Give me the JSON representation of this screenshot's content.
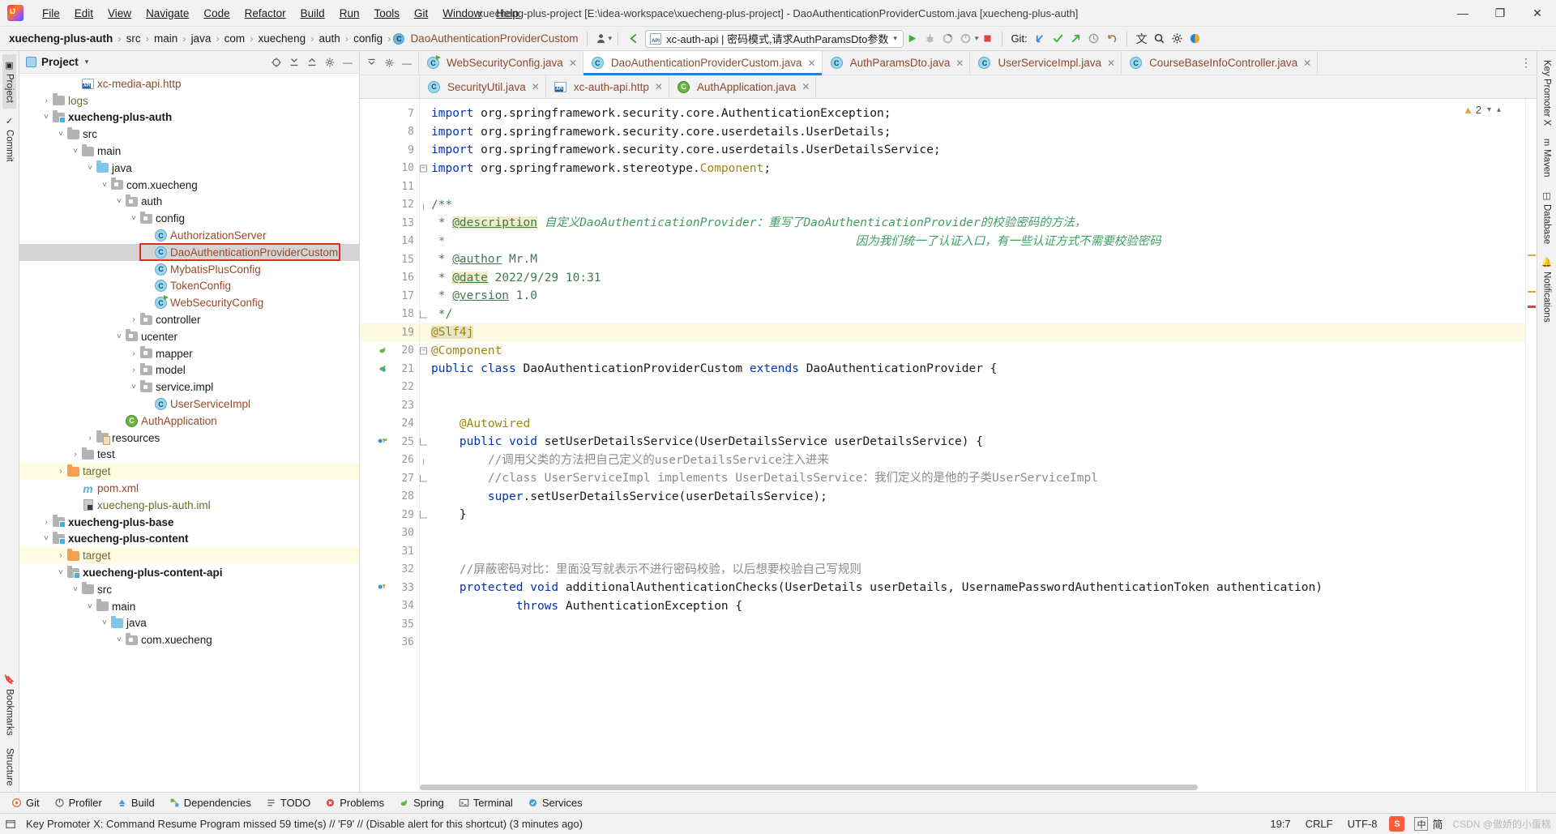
{
  "window": {
    "title": "xuecheng-plus-project [E:\\idea-workspace\\xuecheng-plus-project] - DaoAuthenticationProviderCustom.java [xuecheng-plus-auth]",
    "minimize": "—",
    "maximize": "❐",
    "close": "✕"
  },
  "menu": [
    {
      "label": "File"
    },
    {
      "label": "Edit"
    },
    {
      "label": "View"
    },
    {
      "label": "Navigate"
    },
    {
      "label": "Code"
    },
    {
      "label": "Refactor"
    },
    {
      "label": "Build"
    },
    {
      "label": "Run"
    },
    {
      "label": "Tools"
    },
    {
      "label": "Git"
    },
    {
      "label": "Window"
    },
    {
      "label": "Help"
    }
  ],
  "navbar": {
    "crumbs": [
      {
        "label": "xuecheng-plus-auth",
        "style": "bold"
      },
      {
        "label": "src",
        "style": "normal"
      },
      {
        "label": "main",
        "style": "normal"
      },
      {
        "label": "java",
        "style": "normal"
      },
      {
        "label": "com",
        "style": "normal"
      },
      {
        "label": "xuecheng",
        "style": "normal"
      },
      {
        "label": "auth",
        "style": "normal"
      },
      {
        "label": "config",
        "style": "normal"
      },
      {
        "label": "DaoAuthenticationProviderCustom",
        "style": "class"
      }
    ],
    "separator": "›",
    "run_config": "xc-auth-api | 密码模式,请求AuthParamsDto参数",
    "run_config_caret": "▾",
    "api_badge": "API",
    "git_label": "Git:"
  },
  "left_strip": [
    {
      "label": "Project",
      "icon": "project-icon",
      "active": true
    },
    {
      "label": "Commit",
      "icon": "commit-icon",
      "active": false
    },
    {
      "label": "Bookmarks",
      "icon": "bookmarks-icon",
      "active": false
    },
    {
      "label": "Structure",
      "icon": "structure-icon",
      "active": false
    }
  ],
  "right_strip": [
    {
      "label": "Key Promoter X",
      "icon": "key-icon"
    },
    {
      "label": "Maven",
      "icon": "maven-icon"
    },
    {
      "label": "Database",
      "icon": "database-icon"
    },
    {
      "label": "Notifications",
      "icon": "bell-icon"
    }
  ],
  "project_panel": {
    "title": "Project",
    "caret": "▾",
    "tree": [
      {
        "depth": 4,
        "arrow": "",
        "icon": "http-file",
        "label": "xc-media-api.http",
        "style": "file"
      },
      {
        "depth": 2,
        "arrow": "›",
        "icon": "folder-gray",
        "label": "logs",
        "style": "olive"
      },
      {
        "depth": 2,
        "arrow": "˅",
        "icon": "folder-module",
        "label": "xuecheng-plus-auth",
        "style": "bold"
      },
      {
        "depth": 3,
        "arrow": "˅",
        "icon": "folder-gray",
        "label": "src",
        "style": "normal"
      },
      {
        "depth": 4,
        "arrow": "˅",
        "icon": "folder-gray",
        "label": "main",
        "style": "normal"
      },
      {
        "depth": 5,
        "arrow": "˅",
        "icon": "folder-blue",
        "label": "java",
        "style": "normal"
      },
      {
        "depth": 6,
        "arrow": "˅",
        "icon": "folder-pkg",
        "label": "com.xuecheng",
        "style": "normal"
      },
      {
        "depth": 7,
        "arrow": "˅",
        "icon": "folder-pkg",
        "label": "auth",
        "style": "normal"
      },
      {
        "depth": 8,
        "arrow": "˅",
        "icon": "folder-pkg",
        "label": "config",
        "style": "normal"
      },
      {
        "depth": 9,
        "arrow": "",
        "icon": "class",
        "label": "AuthorizationServer",
        "style": "class"
      },
      {
        "depth": 9,
        "arrow": "",
        "icon": "class",
        "label": "DaoAuthenticationProviderCustom",
        "style": "class",
        "selected": true,
        "highlighted": true
      },
      {
        "depth": 9,
        "arrow": "",
        "icon": "class",
        "label": "MybatisPlusConfig",
        "style": "class"
      },
      {
        "depth": 9,
        "arrow": "",
        "icon": "class",
        "label": "TokenConfig",
        "style": "class"
      },
      {
        "depth": 9,
        "arrow": "",
        "icon": "class-run",
        "label": "WebSecurityConfig",
        "style": "class"
      },
      {
        "depth": 8,
        "arrow": "›",
        "icon": "folder-pkg",
        "label": "controller",
        "style": "normal"
      },
      {
        "depth": 7,
        "arrow": "˅",
        "icon": "folder-pkg",
        "label": "ucenter",
        "style": "normal"
      },
      {
        "depth": 8,
        "arrow": "›",
        "icon": "folder-pkg",
        "label": "mapper",
        "style": "normal"
      },
      {
        "depth": 8,
        "arrow": "›",
        "icon": "folder-pkg",
        "label": "model",
        "style": "normal"
      },
      {
        "depth": 8,
        "arrow": "˅",
        "icon": "folder-pkg",
        "label": "service.impl",
        "style": "normal"
      },
      {
        "depth": 9,
        "arrow": "",
        "icon": "class",
        "label": "UserServiceImpl",
        "style": "class"
      },
      {
        "depth": 7,
        "arrow": "",
        "icon": "spring-class",
        "label": "AuthApplication",
        "style": "class"
      },
      {
        "depth": 5,
        "arrow": "›",
        "icon": "folder-res",
        "label": "resources",
        "style": "normal"
      },
      {
        "depth": 4,
        "arrow": "›",
        "icon": "folder-gray",
        "label": "test",
        "style": "normal"
      },
      {
        "depth": 3,
        "arrow": "›",
        "icon": "folder-orange",
        "label": "target",
        "style": "olive",
        "row_highlight": true
      },
      {
        "depth": 4,
        "arrow": "",
        "icon": "maven",
        "label": "pom.xml",
        "style": "file"
      },
      {
        "depth": 4,
        "arrow": "",
        "icon": "iml",
        "label": "xuecheng-plus-auth.iml",
        "style": "olive"
      },
      {
        "depth": 2,
        "arrow": "›",
        "icon": "folder-module",
        "label": "xuecheng-plus-base",
        "style": "bold"
      },
      {
        "depth": 2,
        "arrow": "˅",
        "icon": "folder-module",
        "label": "xuecheng-plus-content",
        "style": "bold"
      },
      {
        "depth": 3,
        "arrow": "›",
        "icon": "folder-orange",
        "label": "target",
        "style": "olive",
        "row_highlight": true
      },
      {
        "depth": 3,
        "arrow": "˅",
        "icon": "folder-module",
        "label": "xuecheng-plus-content-api",
        "style": "bold"
      },
      {
        "depth": 4,
        "arrow": "˅",
        "icon": "folder-gray",
        "label": "src",
        "style": "normal"
      },
      {
        "depth": 5,
        "arrow": "˅",
        "icon": "folder-gray",
        "label": "main",
        "style": "normal"
      },
      {
        "depth": 6,
        "arrow": "˅",
        "icon": "folder-blue",
        "label": "java",
        "style": "normal"
      },
      {
        "depth": 7,
        "arrow": "˅",
        "icon": "folder-pkg",
        "label": "com.xuecheng",
        "style": "normal"
      }
    ]
  },
  "editor_tabs_row1": [
    {
      "label": "WebSecurityConfig.java",
      "icon": "class-run",
      "active": false
    },
    {
      "label": "DaoAuthenticationProviderCustom.java",
      "icon": "class",
      "active": true
    },
    {
      "label": "AuthParamsDto.java",
      "icon": "class",
      "active": false
    },
    {
      "label": "UserServiceImpl.java",
      "icon": "class",
      "active": false
    },
    {
      "label": "CourseBaseInfoController.java",
      "icon": "class",
      "active": false
    }
  ],
  "editor_tabs_row2": [
    {
      "label": "SecurityUtil.java",
      "icon": "class",
      "active": false
    },
    {
      "label": "xc-auth-api.http",
      "icon": "http-file",
      "active": false
    },
    {
      "label": "AuthApplication.java",
      "icon": "spring-class",
      "active": false
    }
  ],
  "editor": {
    "warning_count": "2",
    "warning_icon": "warning-triangle-icon",
    "first_line": 7,
    "current_line": 19,
    "lines": [
      {
        "n": 7,
        "tokens": [
          {
            "t": "import ",
            "c": "kw"
          },
          {
            "t": "org.springframework.security.core.AuthenticationException;",
            "c": "plain"
          }
        ]
      },
      {
        "n": 8,
        "tokens": [
          {
            "t": "import ",
            "c": "kw"
          },
          {
            "t": "org.springframework.security.core.userdetails.UserDetails;",
            "c": "plain"
          }
        ]
      },
      {
        "n": 9,
        "tokens": [
          {
            "t": "import ",
            "c": "kw"
          },
          {
            "t": "org.springframework.security.core.userdetails.UserDetailsService;",
            "c": "plain"
          }
        ]
      },
      {
        "n": 10,
        "fold": "minus",
        "tokens": [
          {
            "t": "import ",
            "c": "kw"
          },
          {
            "t": "org.springframework.stereotype.",
            "c": "plain"
          },
          {
            "t": "Component",
            "c": "cls-ref"
          },
          {
            "t": ";",
            "c": "plain"
          }
        ]
      },
      {
        "n": 11,
        "tokens": []
      },
      {
        "n": 12,
        "fold": "open",
        "tokens": [
          {
            "t": "/**",
            "c": "jdoc"
          }
        ]
      },
      {
        "n": 13,
        "tokens": [
          {
            "t": " * ",
            "c": "jdoc"
          },
          {
            "t": "@description",
            "c": "jdoc-tag-hl"
          },
          {
            "t": " ",
            "c": "jdoc"
          },
          {
            "t": "自定义DaoAuthenticationProvider：重写了DaoAuthenticationProvider的校验密码的方法，",
            "c": "jdoc-cn"
          }
        ]
      },
      {
        "n": 14,
        "tokens": [
          {
            "t": " *                                                          因为我们统一了认证入口，有一些认证方式不需要校验密码",
            "c": "jdoc-cn"
          }
        ]
      },
      {
        "n": 15,
        "tokens": [
          {
            "t": " * ",
            "c": "jdoc"
          },
          {
            "t": "@author",
            "c": "jdoc-tag"
          },
          {
            "t": " Mr.M",
            "c": "jdoc"
          }
        ]
      },
      {
        "n": 16,
        "tokens": [
          {
            "t": " * ",
            "c": "jdoc"
          },
          {
            "t": "@date",
            "c": "jdoc-tag-hl"
          },
          {
            "t": " 2022/9/29 10:31",
            "c": "jdoc"
          }
        ]
      },
      {
        "n": 17,
        "tokens": [
          {
            "t": " * ",
            "c": "jdoc"
          },
          {
            "t": "@version",
            "c": "jdoc-tag"
          },
          {
            "t": " 1.0",
            "c": "jdoc"
          }
        ]
      },
      {
        "n": 18,
        "fold": "close",
        "tokens": [
          {
            "t": " */",
            "c": "jdoc"
          }
        ]
      },
      {
        "n": 19,
        "current": true,
        "fold": "minus",
        "tokens": [
          {
            "t": "@Slf4j",
            "c": "ann ann-hl"
          }
        ]
      },
      {
        "n": 20,
        "mark": "spring-green",
        "fold": "minus",
        "tokens": [
          {
            "t": "@Component",
            "c": "ann"
          }
        ]
      },
      {
        "n": 21,
        "mark": "bean-blue",
        "tokens": [
          {
            "t": "public ",
            "c": "kw"
          },
          {
            "t": "class ",
            "c": "kw"
          },
          {
            "t": "DaoAuthenticationProviderCustom ",
            "c": "plain"
          },
          {
            "t": "extends ",
            "c": "kw"
          },
          {
            "t": "DaoAuthenticationProvider {",
            "c": "plain"
          }
        ]
      },
      {
        "n": 22,
        "tokens": []
      },
      {
        "n": 23,
        "tokens": []
      },
      {
        "n": 24,
        "tokens": [
          {
            "t": "    @Autowired",
            "c": "ann"
          }
        ]
      },
      {
        "n": 25,
        "mark": "override-impl",
        "fold": "close",
        "tokens": [
          {
            "t": "    public ",
            "c": "kw"
          },
          {
            "t": "void ",
            "c": "kw"
          },
          {
            "t": "setUserDetailsService(UserDetailsService userDetailsService) {",
            "c": "plain"
          }
        ]
      },
      {
        "n": 26,
        "fold": "open",
        "tokens": [
          {
            "t": "        //调用父类的方法把自己定义的userDetailsService注入进来",
            "c": "cmt"
          }
        ]
      },
      {
        "n": 27,
        "fold": "close",
        "tokens": [
          {
            "t": "        //class UserServiceImpl implements UserDetailsService：我们定义的是他的子类UserServiceImpl",
            "c": "cmt"
          }
        ]
      },
      {
        "n": 28,
        "tokens": [
          {
            "t": "        super",
            "c": "kw"
          },
          {
            "t": ".setUserDetailsService(userDetailsService);",
            "c": "plain"
          }
        ]
      },
      {
        "n": 29,
        "fold": "close",
        "tokens": [
          {
            "t": "    }",
            "c": "plain"
          }
        ]
      },
      {
        "n": 30,
        "tokens": []
      },
      {
        "n": 31,
        "tokens": []
      },
      {
        "n": 32,
        "tokens": [
          {
            "t": "    //屏蔽密码对比：里面没写就表示不进行密码校验，以后想要校验自己写规则",
            "c": "cmt"
          }
        ]
      },
      {
        "n": 33,
        "mark": "override",
        "tokens": [
          {
            "t": "    protected ",
            "c": "kw"
          },
          {
            "t": "void ",
            "c": "kw"
          },
          {
            "t": "additionalAuthenticationChecks(UserDetails userDetails, UsernamePasswordAuthenticationToken authentication)",
            "c": "plain"
          }
        ]
      },
      {
        "n": 34,
        "tokens": [
          {
            "t": "            throws ",
            "c": "kw"
          },
          {
            "t": "AuthenticationException {",
            "c": "plain"
          }
        ]
      },
      {
        "n": 35,
        "tokens": []
      },
      {
        "n": 36,
        "tokens": []
      }
    ]
  },
  "bottom_tools": [
    {
      "label": "Git",
      "icon": "git-icon"
    },
    {
      "label": "Profiler",
      "icon": "profiler-icon"
    },
    {
      "label": "Build",
      "icon": "build-icon"
    },
    {
      "label": "Dependencies",
      "icon": "dependencies-icon"
    },
    {
      "label": "TODO",
      "icon": "todo-icon"
    },
    {
      "label": "Problems",
      "icon": "problems-icon"
    },
    {
      "label": "Spring",
      "icon": "spring-icon"
    },
    {
      "label": "Terminal",
      "icon": "terminal-icon"
    },
    {
      "label": "Services",
      "icon": "services-icon"
    }
  ],
  "statusbar": {
    "message": "Key Promoter X: Command Resume Program missed 59 time(s) // 'F9' // (Disable alert for this shortcut) (3 minutes ago)",
    "caret_position": "19:7",
    "line_separator": "CRLF",
    "encoding": "UTF-8",
    "ime_label": "中",
    "ime_mode": "简",
    "watermark": "CSDN @傲娇的小蛋糕"
  }
}
